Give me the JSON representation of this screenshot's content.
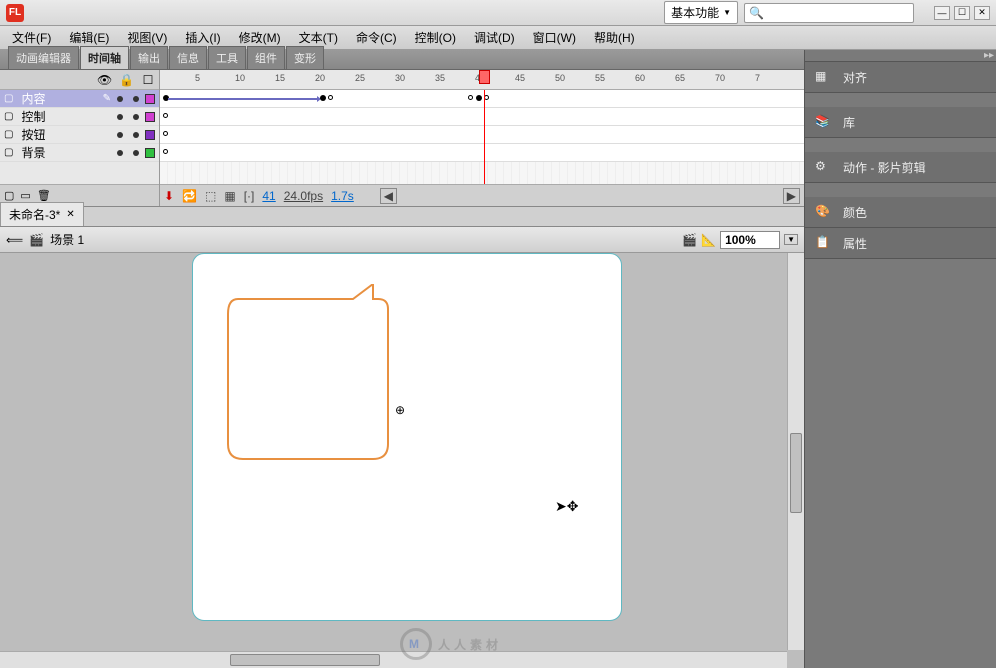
{
  "titlebar": {
    "logo": "FL",
    "workspace": "基本功能",
    "search_placeholder": ""
  },
  "menu": {
    "items": [
      {
        "label": "文件(F)"
      },
      {
        "label": "编辑(E)"
      },
      {
        "label": "视图(V)"
      },
      {
        "label": "插入(I)"
      },
      {
        "label": "修改(M)"
      },
      {
        "label": "文本(T)"
      },
      {
        "label": "命令(C)"
      },
      {
        "label": "控制(O)"
      },
      {
        "label": "调试(D)"
      },
      {
        "label": "窗口(W)"
      },
      {
        "label": "帮助(H)"
      }
    ]
  },
  "panel_tabs": [
    {
      "label": "动画编辑器",
      "active": false
    },
    {
      "label": "时间轴",
      "active": true
    },
    {
      "label": "输出",
      "active": false
    },
    {
      "label": "信息",
      "active": false
    },
    {
      "label": "工具",
      "active": false
    },
    {
      "label": "组件",
      "active": false
    },
    {
      "label": "变形",
      "active": false
    }
  ],
  "timeline": {
    "ruler_marks": [
      5,
      10,
      15,
      20,
      25,
      30,
      35,
      40,
      45,
      50,
      55,
      60,
      65,
      70,
      "7"
    ],
    "layers": [
      {
        "name": "内容",
        "selected": true,
        "color": "#d040d0"
      },
      {
        "name": "控制",
        "selected": false,
        "color": "#d040d0"
      },
      {
        "name": "按钮",
        "selected": false,
        "color": "#8030c0"
      },
      {
        "name": "背景",
        "selected": false,
        "color": "#30c040"
      }
    ],
    "status": {
      "frame": "41",
      "fps": "24.0fps",
      "time": "1.7s"
    },
    "playhead_frame": 41
  },
  "document": {
    "tab_name": "未命名-3*"
  },
  "scene": {
    "name": "场景 1",
    "zoom": "100%"
  },
  "right_panels": [
    {
      "icon": "align-icon",
      "label": "对齐"
    },
    {
      "icon": "library-icon",
      "label": "库"
    },
    {
      "icon": "actions-icon",
      "label": "动作 - 影片剪辑"
    },
    {
      "icon": "color-icon",
      "label": "颜色"
    },
    {
      "icon": "properties-icon",
      "label": "属性"
    }
  ],
  "watermark": "人人素材"
}
